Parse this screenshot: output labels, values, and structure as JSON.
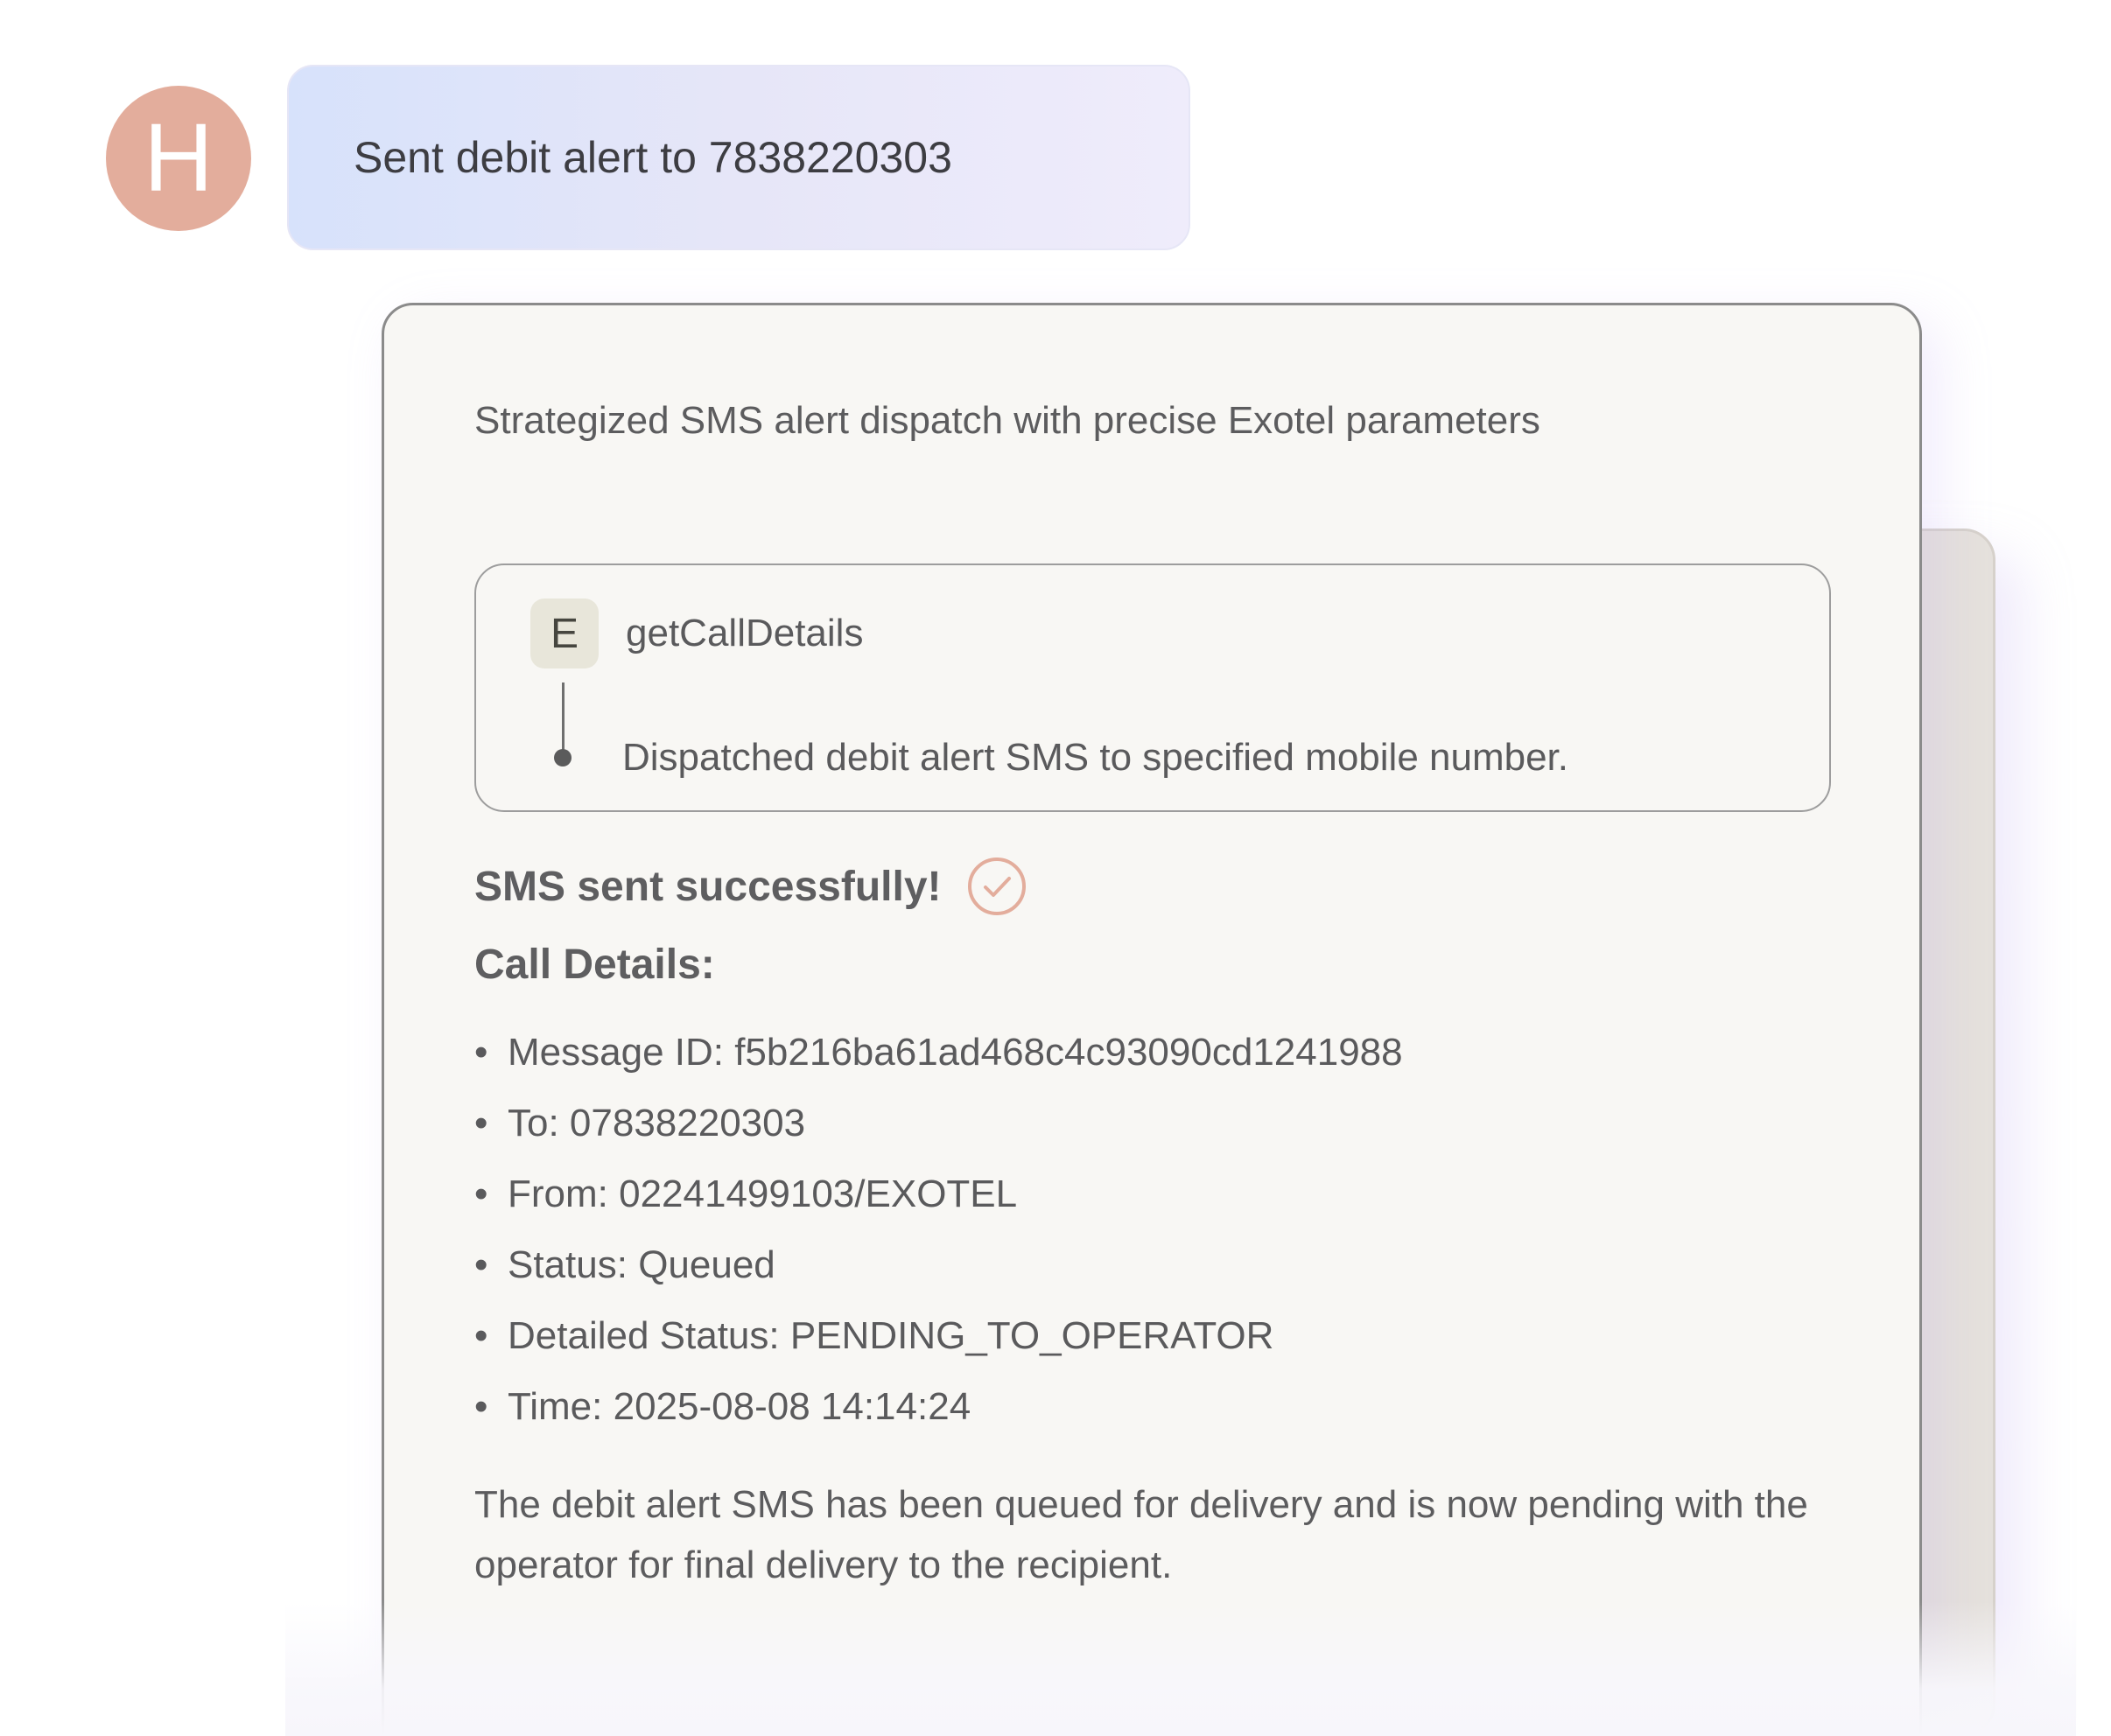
{
  "user_message": {
    "avatar_letter": "H",
    "text": "Sent debit alert to 7838220303"
  },
  "assistant_card": {
    "summary": "Strategized SMS alert dispatch with precise Exotel parameters",
    "tool_call": {
      "badge_letter": "E",
      "name": "getCallDetails",
      "result": "Dispatched debit alert SMS to specified mobile number."
    },
    "success_text": "SMS sent successfully!",
    "success_icon": "check-circle-icon",
    "details_title": "Call Details:",
    "details": [
      "Message ID: f5b216ba61ad468c4c93090cd1241988",
      "To: 07838220303",
      "From: 02241499103/EXOTEL",
      "Status: Queued",
      "Detailed Status: PENDING_TO_OPERATOR",
      "Time: 2025-08-08 14:14:24"
    ],
    "closing": "The debit alert SMS has been queued for delivery and is now pending with the operator for final delivery to the recipient."
  },
  "colors": {
    "avatar": "#e3ad9c",
    "accent_check": "#e3ad9c",
    "card_background": "#f8f7f4",
    "text": "#5a5a5c"
  }
}
